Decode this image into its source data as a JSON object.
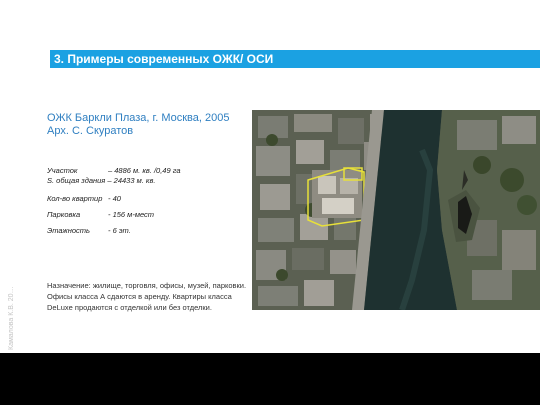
{
  "header": {
    "title": "3. Примеры современных ОЖК/ ОСИ"
  },
  "subtitle": {
    "line1": "ОЖК Баркли Плаза, г. Москва, 2005",
    "line2": "Арх. С. Скуратов"
  },
  "facts": {
    "plot_label": "Участок",
    "plot_value": "– 4886 м. кв. /0,49 га",
    "area_full": "S. общая здания – 24433 м. кв.",
    "apartments_label": "Кол-во квартир",
    "apartments_value": "- 40",
    "parking_label": "Парковка",
    "parking_value": "- 156 м-мест",
    "floors_label": "Этажность",
    "floors_value": "- 6 эт."
  },
  "description": "Назначение: жилище, торговля, офисы, музей, парковки. Офисы класса А сдаются в аренду. Квартиры класса DeLuxe продаются с отделкой или без отделки.",
  "author": "Камалова К.В. 20…",
  "colors": {
    "accent": "#1ba1e2",
    "subtitle": "#2f7fc1"
  }
}
